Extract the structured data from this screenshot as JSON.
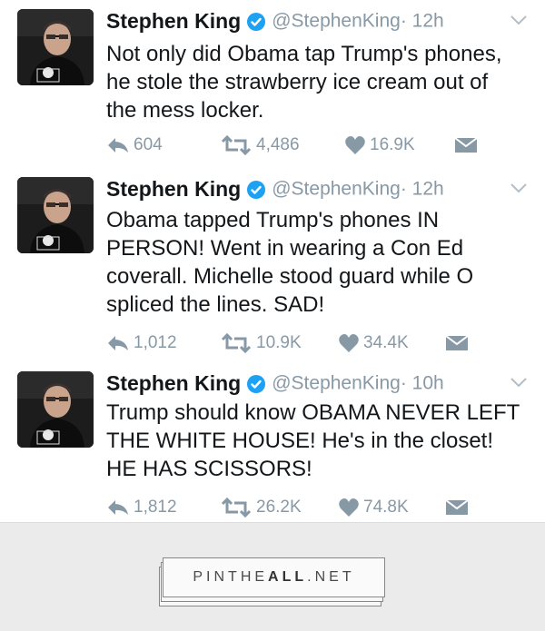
{
  "tweets": [
    {
      "name": "Stephen King",
      "handle": "@StephenKing",
      "time": "· 12h",
      "lines": [
        "Not only did Obama tap Trump's phones,",
        "he stole the strawberry ice cream out of",
        "the mess locker."
      ],
      "replies": "604",
      "retweets": "4,486",
      "likes": "16.9K"
    },
    {
      "name": "Stephen King",
      "handle": "@StephenKing",
      "time": "· 12h",
      "lines": [
        "Obama tapped Trump's phones IN",
        "PERSON! Went in wearing a Con Ed",
        "coverall. Michelle stood guard while O",
        "spliced the lines. SAD!"
      ],
      "replies": "1,012",
      "retweets": "10.9K",
      "likes": "34.4K"
    },
    {
      "name": "Stephen King",
      "handle": "@StephenKing",
      "time": "· 10h",
      "lines": [
        "Trump should know OBAMA NEVER LEFT",
        "THE WHITE HOUSE! He's in the closet!",
        "HE HAS SCISSORS!"
      ],
      "replies": "1,812",
      "retweets": "26.2K",
      "likes": "74.8K"
    }
  ],
  "watermark": {
    "part1": "PIN",
    "part2": "THE",
    "part3": "ALL",
    "part4": ".NET"
  },
  "colors": {
    "verified": "#1da1f2",
    "muted": "#8899a6",
    "text": "#14171a"
  },
  "icons": [
    "reply-icon",
    "retweet-icon",
    "like-icon",
    "direct-message-icon",
    "chevron-down-icon",
    "verified-icon"
  ]
}
